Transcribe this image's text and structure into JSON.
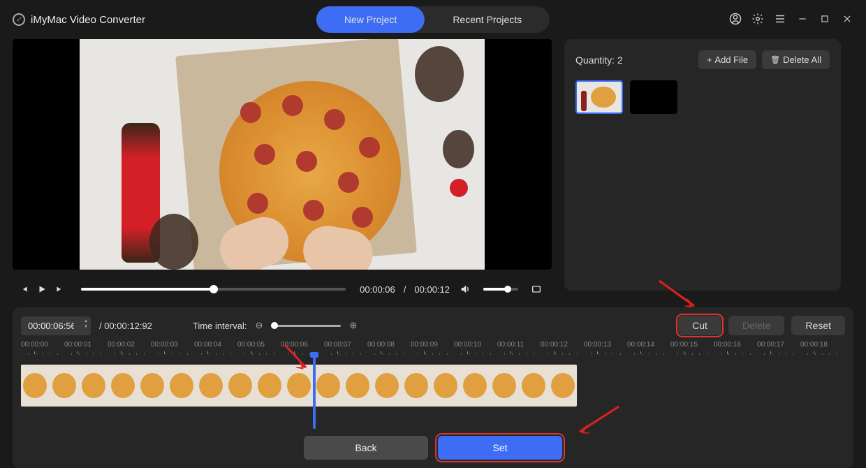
{
  "app": {
    "title": "iMyMac Video Converter"
  },
  "tabs": {
    "new_project": "New Project",
    "recent_projects": "Recent Projects",
    "active": "new_project"
  },
  "player": {
    "current_time": "00:00:06",
    "duration": "00:00:12",
    "progress_pct": 50
  },
  "right_panel": {
    "quantity_label": "Quantity:",
    "quantity_value": "2",
    "add_file": "Add File",
    "delete_all": "Delete All"
  },
  "editor": {
    "time_position": "00:00:06:56",
    "duration_full": "00:00:12:92",
    "interval_label": "Time interval:",
    "actions": {
      "cut": "Cut",
      "delete": "Delete",
      "reset": "Reset"
    },
    "back": "Back",
    "set": "Set"
  },
  "ruler": {
    "ticks": [
      "00:00:00",
      "00:00:01",
      "00:00:02",
      "00:00:03",
      "00:00:04",
      "00:00:05",
      "00:00:06",
      "00:00:07",
      "00:00:08",
      "00:00:09",
      "00:00:10",
      "00:00:11",
      "00:00:12",
      "00:00:13",
      "00:00:14",
      "00:00:15",
      "00:00:16",
      "00:00:17",
      "00:00:18"
    ]
  },
  "colors": {
    "accent": "#3d6cf5",
    "annotation": "#e02020"
  }
}
